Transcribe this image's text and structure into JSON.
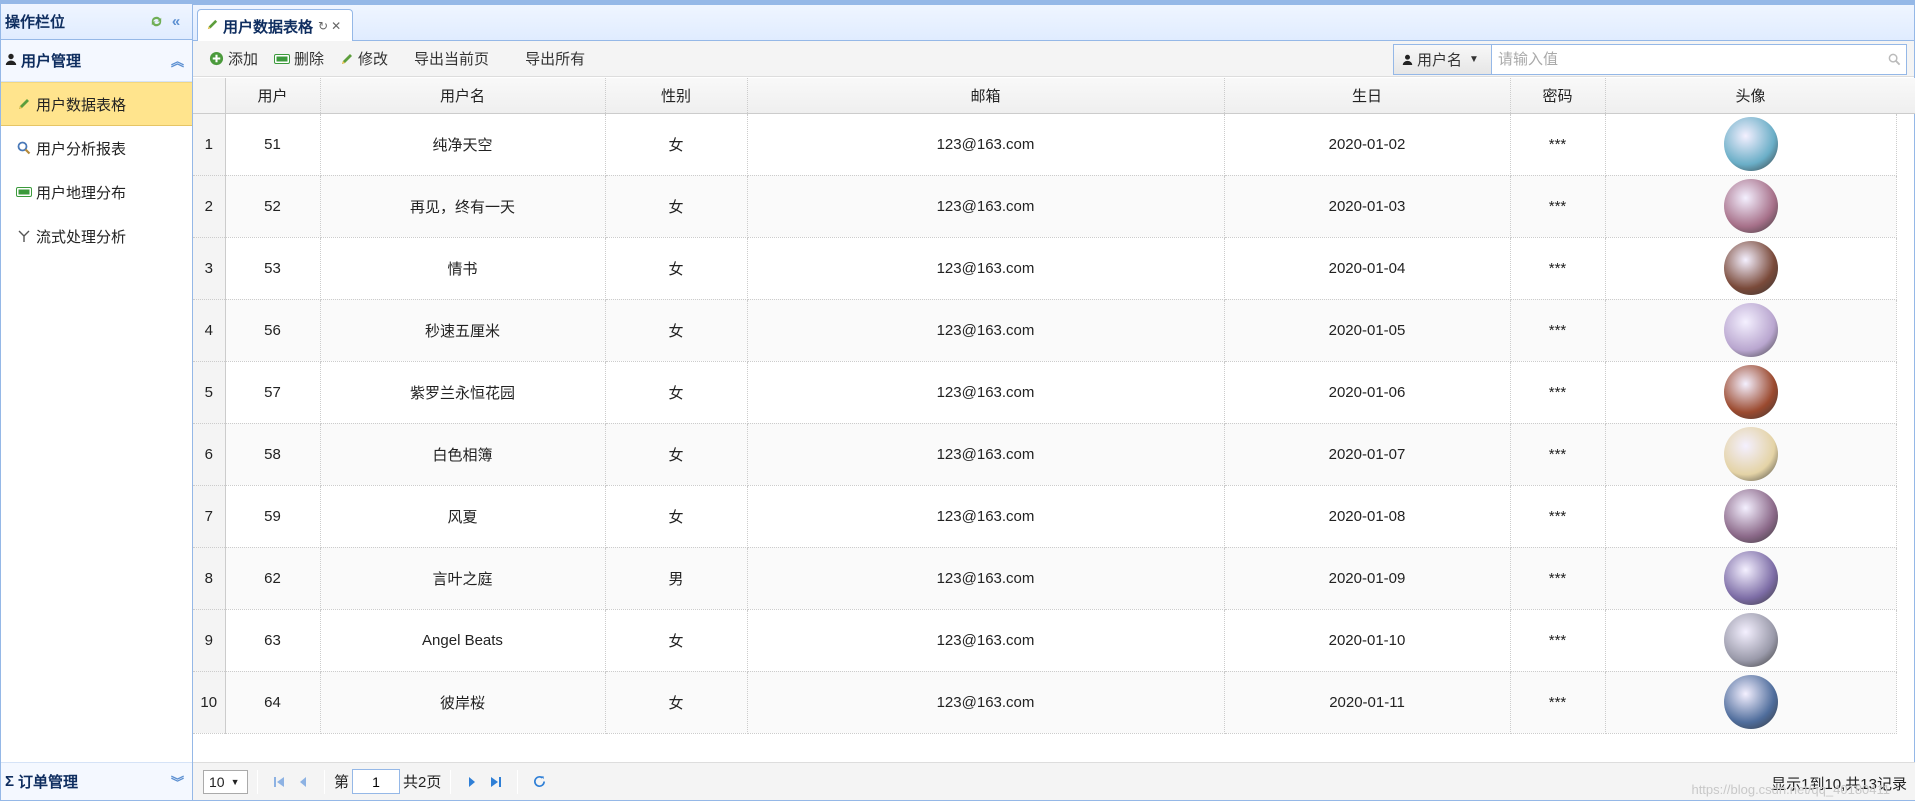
{
  "sidebar": {
    "title": "操作栏位",
    "sections": [
      {
        "label": "用户管理",
        "items": [
          {
            "label": "用户数据表格",
            "icon": "pencil-icon",
            "active": true
          },
          {
            "label": "用户分析报表",
            "icon": "magnifier-icon",
            "active": false
          },
          {
            "label": "用户地理分布",
            "icon": "map-bar-icon",
            "active": false
          },
          {
            "label": "流式处理分析",
            "icon": "filter-icon",
            "active": false
          }
        ]
      }
    ],
    "footer_section": {
      "label": "订单管理",
      "icon": "sigma-icon"
    }
  },
  "tabs": [
    {
      "label": "用户数据表格"
    }
  ],
  "toolbar": {
    "add_label": "添加",
    "delete_label": "删除",
    "edit_label": "修改",
    "export_page_label": "导出当前页",
    "export_all_label": "导出所有"
  },
  "search": {
    "field_label": "用户名",
    "placeholder": "请输入值",
    "value": ""
  },
  "grid": {
    "columns": [
      "用户",
      "用户名",
      "性别",
      "邮箱",
      "生日",
      "密码",
      "头像"
    ],
    "rows": [
      {
        "n": "1",
        "id": "51",
        "name": "纯净天空",
        "sex": "女",
        "email": "123@163.com",
        "birthday": "2020-01-02",
        "pwd": "***"
      },
      {
        "n": "2",
        "id": "52",
        "name": "再见，终有一天",
        "sex": "女",
        "email": "123@163.com",
        "birthday": "2020-01-03",
        "pwd": "***"
      },
      {
        "n": "3",
        "id": "53",
        "name": "情书",
        "sex": "女",
        "email": "123@163.com",
        "birthday": "2020-01-04",
        "pwd": "***"
      },
      {
        "n": "4",
        "id": "56",
        "name": "秒速五厘米",
        "sex": "女",
        "email": "123@163.com",
        "birthday": "2020-01-05",
        "pwd": "***"
      },
      {
        "n": "5",
        "id": "57",
        "name": "紫罗兰永恒花园",
        "sex": "女",
        "email": "123@163.com",
        "birthday": "2020-01-06",
        "pwd": "***"
      },
      {
        "n": "6",
        "id": "58",
        "name": "白色相簿",
        "sex": "女",
        "email": "123@163.com",
        "birthday": "2020-01-07",
        "pwd": "***"
      },
      {
        "n": "7",
        "id": "59",
        "name": "风夏",
        "sex": "女",
        "email": "123@163.com",
        "birthday": "2020-01-08",
        "pwd": "***"
      },
      {
        "n": "8",
        "id": "62",
        "name": "言叶之庭",
        "sex": "男",
        "email": "123@163.com",
        "birthday": "2020-01-09",
        "pwd": "***"
      },
      {
        "n": "9",
        "id": "63",
        "name": "Angel Beats",
        "sex": "女",
        "email": "123@163.com",
        "birthday": "2020-01-10",
        "pwd": "***"
      },
      {
        "n": "10",
        "id": "64",
        "name": "彼岸桜",
        "sex": "女",
        "email": "123@163.com",
        "birthday": "2020-01-11",
        "pwd": "***"
      }
    ],
    "avatar_colors": [
      "#6aaec7",
      "#a7718a",
      "#7a4a3a",
      "#b9a6cf",
      "#9b4a2f",
      "#e4d3a6",
      "#8c6a8a",
      "#7d6da6",
      "#9a9aaa",
      "#4f6d9c"
    ]
  },
  "pager": {
    "page_size": "10",
    "page_prefix": "第",
    "current_page": "1",
    "page_total": "共2页",
    "info": "显示1到10,共13记录"
  },
  "watermark": "https://blog.csdn.net/qq_40180411"
}
